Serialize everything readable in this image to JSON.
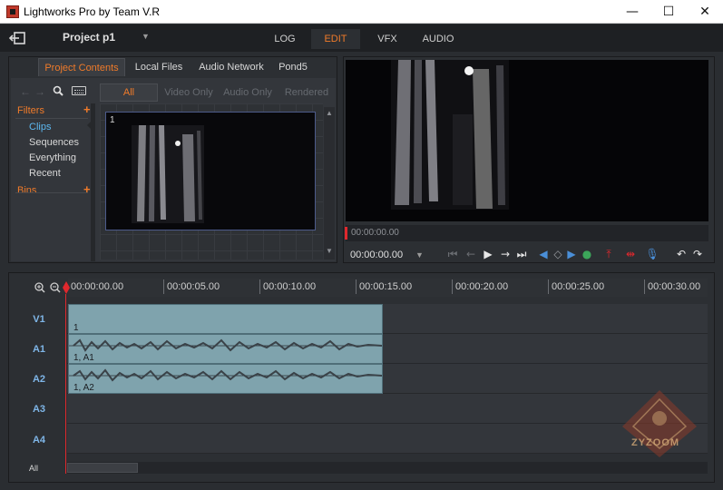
{
  "window": {
    "title": "Lightworks Pro by Team V.R",
    "minimize": "—",
    "maximize": "☐",
    "close": "✕"
  },
  "topbar": {
    "project_name": "Project p1",
    "dropdown_glyph": "▼",
    "tabs": [
      {
        "label": "LOG",
        "active": false
      },
      {
        "label": "EDIT",
        "active": true
      },
      {
        "label": "VFX",
        "active": false
      },
      {
        "label": "AUDIO",
        "active": false
      }
    ]
  },
  "content_panel": {
    "tabs": [
      "Project Contents",
      "Local Files",
      "Audio Network",
      "Pond5"
    ],
    "filters_heading": "Filters",
    "filter_items": [
      "Clips",
      "Sequences",
      "Everything",
      "Recent"
    ],
    "bins_heading": "Bins",
    "plus_glyph": "+",
    "filter_tabs": [
      "All",
      "Video Only",
      "Audio Only",
      "Rendered"
    ],
    "clip_number": "1"
  },
  "viewer": {
    "timecode_bar": "00:00:00.00",
    "timecode": "00:00:00.00"
  },
  "timeline": {
    "ruler_labels": [
      "00:00:00.00",
      "00:00:05.00",
      "00:00:10.00",
      "00:00:15.00",
      "00:00:20.00",
      "00:00:25.00",
      "00:00:30.00"
    ],
    "tracks": [
      "V1",
      "A1",
      "A2",
      "A3",
      "A4"
    ],
    "clip_labels": {
      "v1": "1",
      "a1": "1, A1",
      "a2": "1, A2"
    },
    "all_label": "All"
  },
  "watermark": {
    "text": "ZYZOOM"
  },
  "colors": {
    "accent": "#f07b2a",
    "track_label": "#7fb6e8",
    "clip": "#7fa3ad",
    "playhead": "#e0282d",
    "selected_filter": "#5db8f0"
  }
}
